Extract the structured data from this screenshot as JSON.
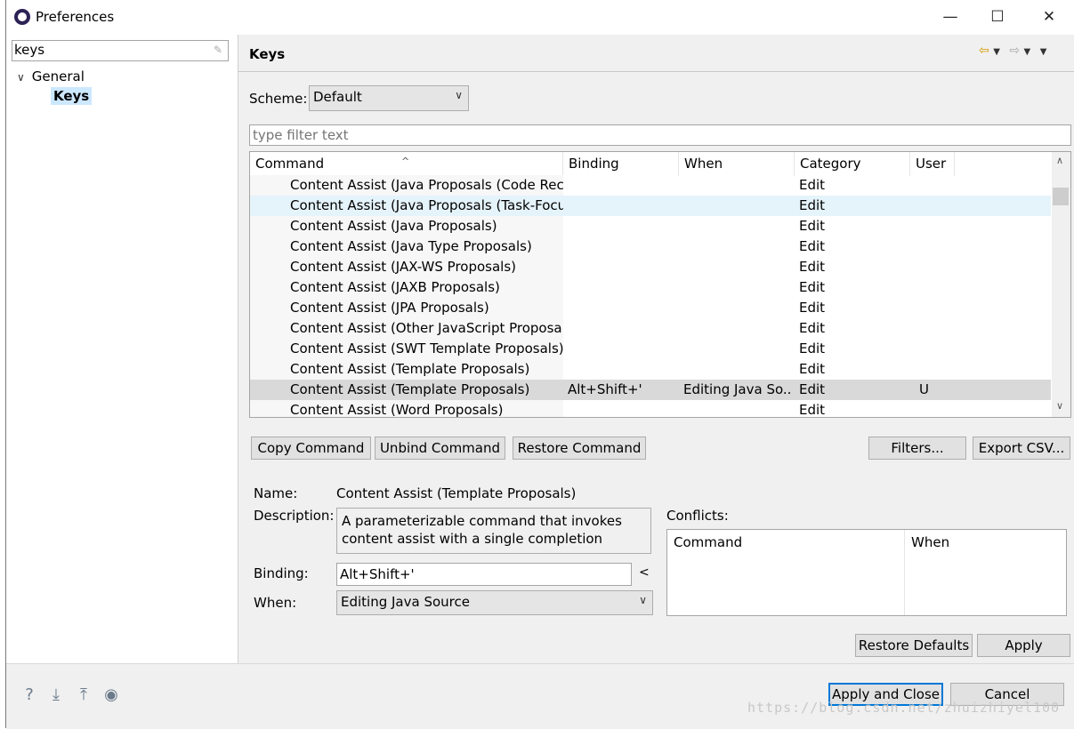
{
  "window": {
    "title": "Preferences",
    "controls": {
      "minimize": "—",
      "maximize": "☐",
      "close": "✕"
    }
  },
  "left": {
    "filter_value": "keys",
    "tree": {
      "general": "General",
      "keys": "Keys"
    }
  },
  "page": {
    "title": "Keys",
    "scheme_label": "Scheme:",
    "scheme_value": "Default",
    "filter_placeholder": "type filter text",
    "columns": {
      "command": "Command",
      "binding": "Binding",
      "when": "When",
      "category": "Category",
      "user": "User"
    },
    "rows": [
      {
        "command": "Content Assist (Java Proposals (Code Recommenders))",
        "binding": "",
        "when": "",
        "category": "Edit",
        "user": ""
      },
      {
        "command": "Content Assist (Java Proposals (Task-Focused))",
        "binding": "",
        "when": "",
        "category": "Edit",
        "user": ""
      },
      {
        "command": "Content Assist (Java Proposals)",
        "binding": "",
        "when": "",
        "category": "Edit",
        "user": ""
      },
      {
        "command": "Content Assist (Java Type Proposals)",
        "binding": "",
        "when": "",
        "category": "Edit",
        "user": ""
      },
      {
        "command": "Content Assist (JAX-WS Proposals)",
        "binding": "",
        "when": "",
        "category": "Edit",
        "user": ""
      },
      {
        "command": "Content Assist (JAXB Proposals)",
        "binding": "",
        "when": "",
        "category": "Edit",
        "user": ""
      },
      {
        "command": "Content Assist (JPA Proposals)",
        "binding": "",
        "when": "",
        "category": "Edit",
        "user": ""
      },
      {
        "command": "Content Assist (Other JavaScript Proposals)",
        "binding": "",
        "when": "",
        "category": "Edit",
        "user": ""
      },
      {
        "command": "Content Assist (SWT Template Proposals)",
        "binding": "",
        "when": "",
        "category": "Edit",
        "user": ""
      },
      {
        "command": "Content Assist (Template Proposals)",
        "binding": "",
        "when": "",
        "category": "Edit",
        "user": ""
      },
      {
        "command": "Content Assist (Template Proposals)",
        "binding": "Alt+Shift+'",
        "when": "Editing Java So...",
        "category": "Edit",
        "user": "U"
      },
      {
        "command": "Content Assist (Word Proposals)",
        "binding": "",
        "when": "",
        "category": "Edit",
        "user": ""
      }
    ],
    "buttons": {
      "copy_command": "Copy Command",
      "unbind_command": "Unbind Command",
      "restore_command": "Restore Command",
      "filters": "Filters...",
      "export_csv": "Export CSV..."
    },
    "details": {
      "name_label": "Name:",
      "name_value": "Content Assist (Template Proposals)",
      "description_label": "Description:",
      "description_value": "A parameterizable command that invokes content assist with a single completion",
      "binding_label": "Binding:",
      "binding_value": "Alt+Shift+'",
      "binding_menu_icon": "<",
      "when_label": "When:",
      "when_value": "Editing Java Source",
      "conflicts_label": "Conflicts:",
      "conflicts_columns": {
        "command": "Command",
        "when": "When"
      }
    },
    "restore_defaults": "Restore Defaults",
    "apply": "Apply"
  },
  "bottom": {
    "icons": [
      "help-icon",
      "import-icon",
      "export-icon",
      "record-icon"
    ],
    "apply_and_close": "Apply and Close",
    "cancel": "Cancel",
    "watermark": "https://blog.csdn.net/zhuizhiyel100"
  }
}
